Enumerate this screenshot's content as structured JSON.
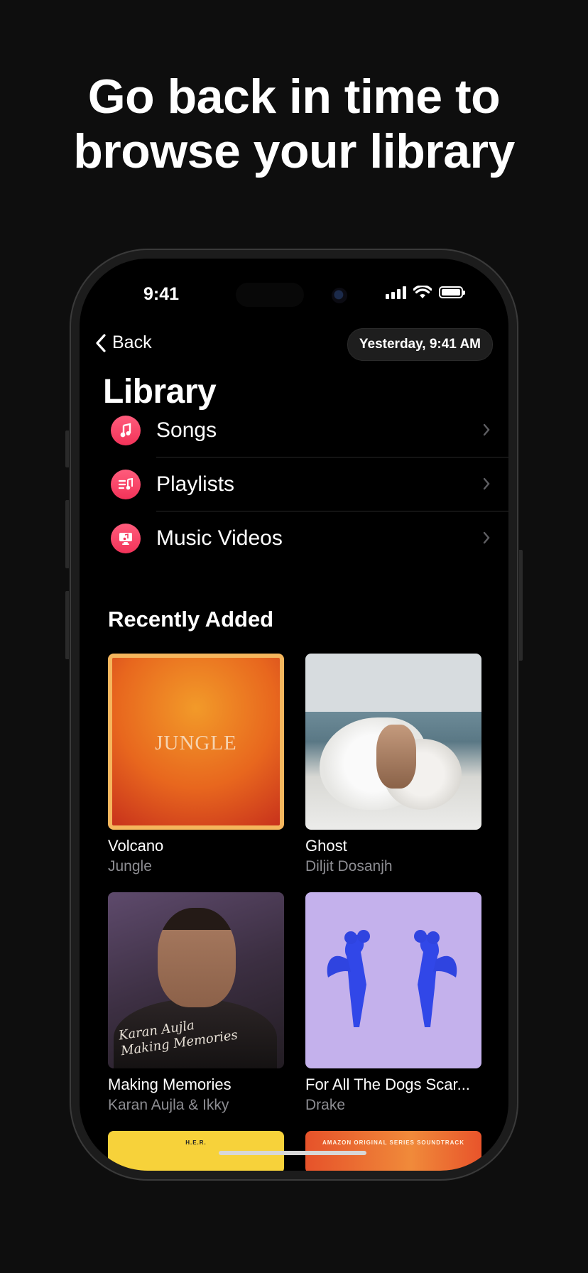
{
  "headline": {
    "line1": "Go back in time to",
    "line2": "browse your library"
  },
  "status_bar": {
    "time": "9:41",
    "signal_bars": 4,
    "battery_level": 1.0
  },
  "nav": {
    "back_label": "Back",
    "date_label": "Yesterday, 9:41 AM"
  },
  "library": {
    "title": "Library",
    "items": [
      {
        "label": "Songs",
        "icon": "music-note-icon"
      },
      {
        "label": "Playlists",
        "icon": "playlist-icon"
      },
      {
        "label": "Music Videos",
        "icon": "music-video-icon"
      }
    ]
  },
  "recently_added": {
    "title": "Recently Added",
    "albums": [
      {
        "title": "Volcano",
        "artist": "Jungle",
        "cover_text": "JUNGLE"
      },
      {
        "title": "Ghost",
        "artist": "Diljit Dosanjh"
      },
      {
        "title": "Making Memories",
        "artist": "Karan Aujla & Ikky",
        "cover_text": "Karan Aujla Making Memories"
      },
      {
        "title": "For All The Dogs Scar...",
        "artist": "Drake"
      },
      {
        "title": "",
        "artist": "",
        "cover_text": "H.E.R."
      },
      {
        "title": "",
        "artist": "",
        "cover_text": "AMAZON ORIGINAL SERIES SOUNDTRACK"
      }
    ]
  },
  "colors": {
    "accent": "#f23359",
    "background": "#000000",
    "secondary_text": "#8d8d92"
  }
}
